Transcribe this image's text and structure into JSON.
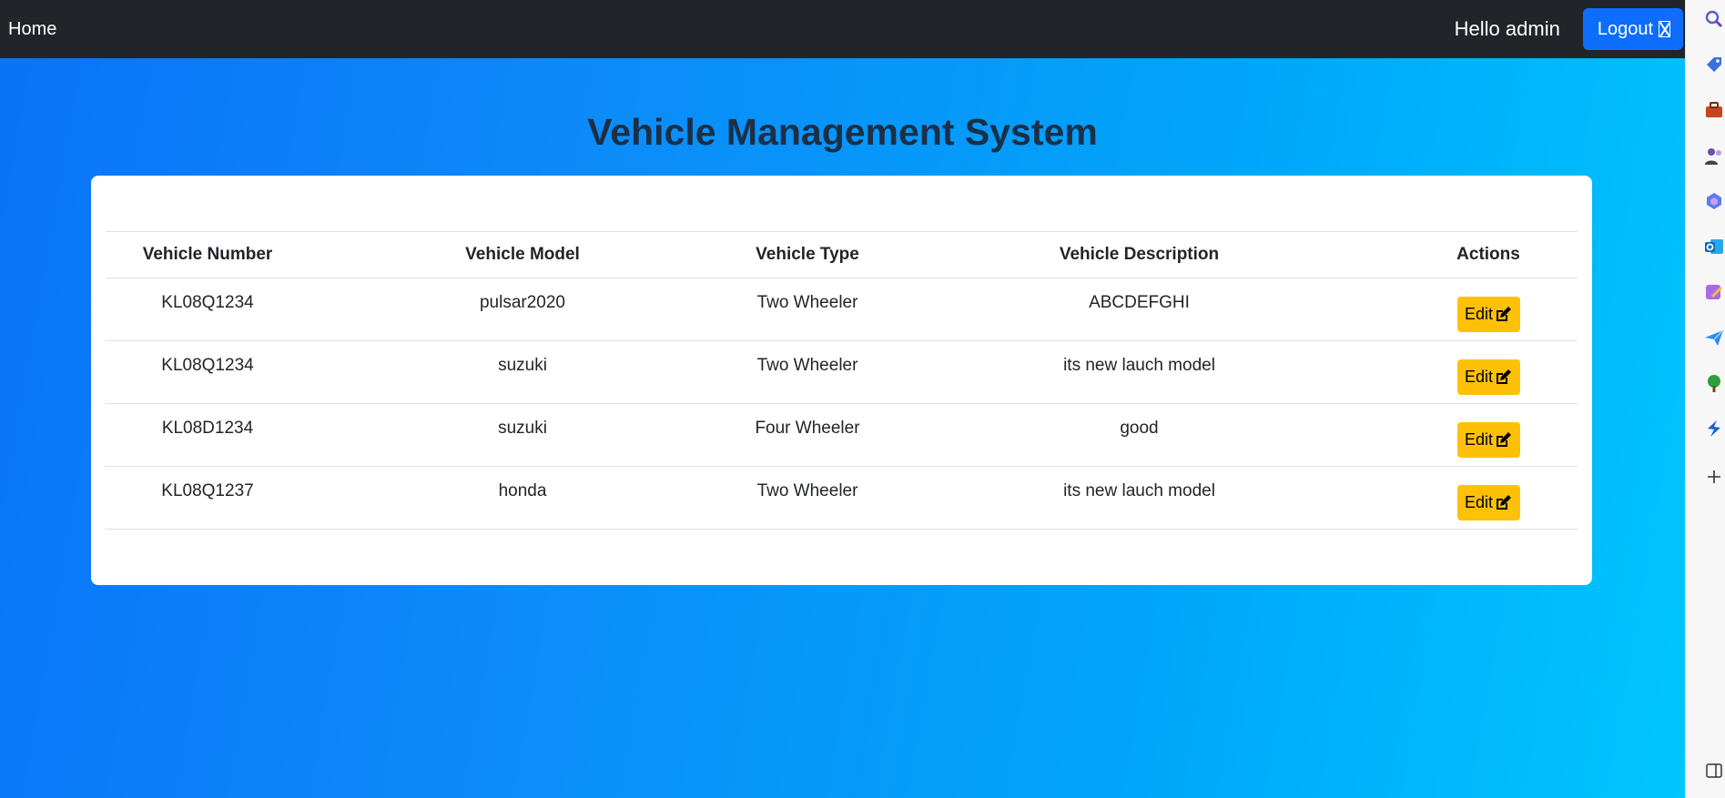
{
  "navbar": {
    "home_label": "Home",
    "greeting": "Hello admin",
    "logout_label": "Logout"
  },
  "page_title": "Vehicle Management System",
  "table": {
    "headers": [
      "Vehicle Number",
      "Vehicle Model",
      "Vehicle Type",
      "Vehicle Description",
      "Actions"
    ],
    "rows": [
      {
        "number": "KL08Q1234",
        "model": "pulsar2020",
        "type": "Two Wheeler",
        "description": "ABCDEFGHI",
        "action": "Edit"
      },
      {
        "number": "KL08Q1234",
        "model": "suzuki",
        "type": "Two Wheeler",
        "description": "its new lauch model",
        "action": "Edit"
      },
      {
        "number": "KL08D1234",
        "model": "suzuki",
        "type": "Four Wheeler",
        "description": "good",
        "action": "Edit"
      },
      {
        "number": "KL08Q1237",
        "model": "honda",
        "type": "Two Wheeler",
        "description": "its new lauch model",
        "action": "Edit"
      }
    ]
  },
  "sidebar_icons": [
    "search-icon",
    "tag-icon",
    "briefcase-icon",
    "people-icon",
    "copilot-icon",
    "outlook-icon",
    "designer-icon",
    "send-icon",
    "tree-icon",
    "app-icon",
    "plus-icon",
    "sidebar-toggle-icon"
  ],
  "colors": {
    "navbar_bg": "#212529",
    "logout_bg": "#0d6efd",
    "edit_bg": "#ffc107",
    "gradient_start": "#0a73f7",
    "gradient_end": "#00c6fd",
    "title_color": "#1c2f45"
  }
}
